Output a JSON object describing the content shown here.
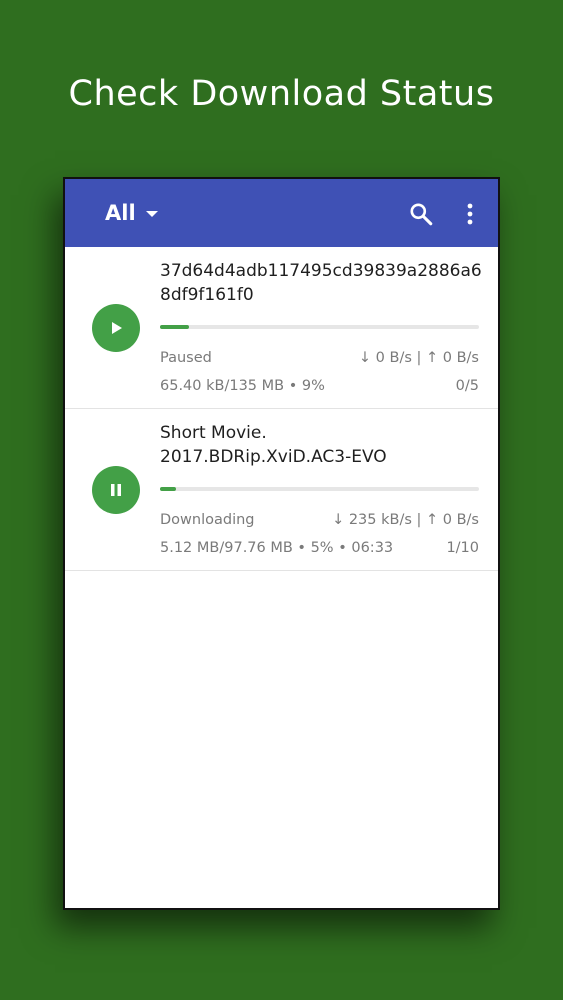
{
  "headline": "Check Download Status",
  "appbar": {
    "filter_label": "All",
    "icons": [
      "search-icon",
      "more-vert-icon"
    ]
  },
  "downloads": [
    {
      "name": "37d64d4adb117495cd39839a2886a68df9f161f0",
      "action_icon": "play-icon",
      "progress": 0.09,
      "status": "Paused",
      "speed": "↓ 0 B/s | ↑ 0 B/s",
      "size_info": "65.40 kB/135 MB • 9%",
      "files": "0/5"
    },
    {
      "name": "Short Movie.\n2017.BDRip.XviD.AC3-EVO",
      "action_icon": "pause-icon",
      "progress": 0.05,
      "status": "Downloading",
      "speed": "↓ 235 kB/s | ↑ 0 B/s",
      "size_info": "5.12 MB/97.76 MB • 5% • 06:33",
      "files": "1/10"
    }
  ],
  "colors": {
    "background": "#2f6e1f",
    "appbar": "#3f51b5",
    "accent": "#43a047"
  }
}
